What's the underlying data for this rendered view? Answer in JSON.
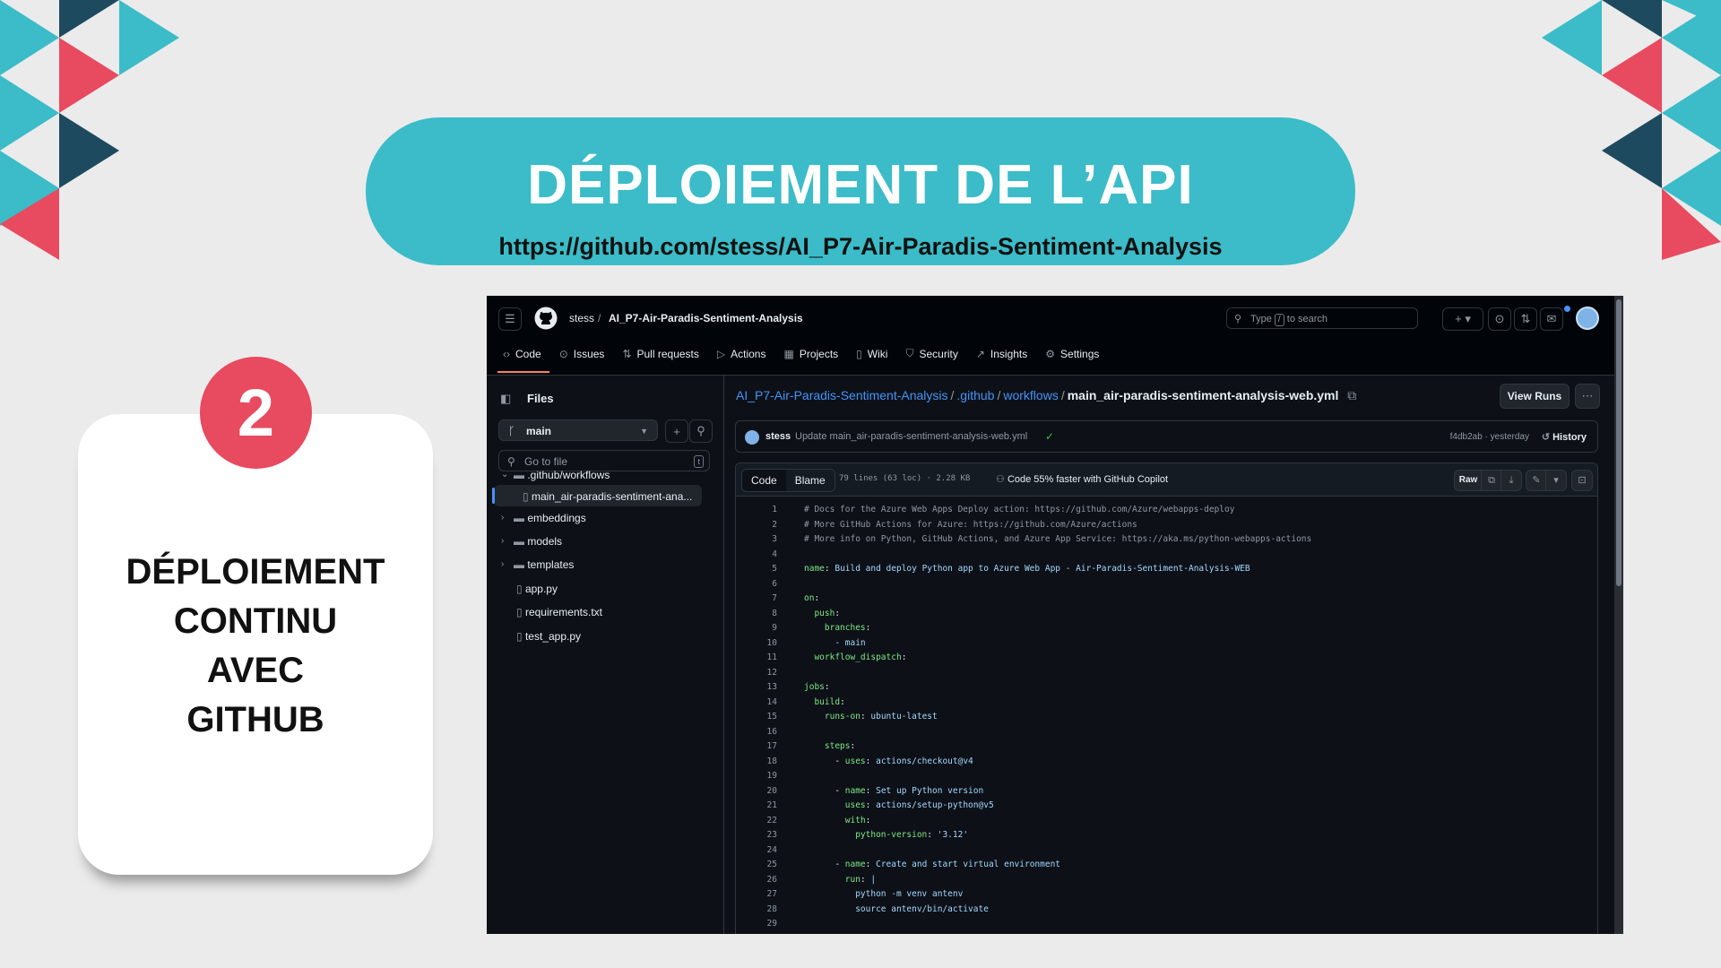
{
  "slide": {
    "title": "DÉPLOIEMENT DE L’API",
    "url": "https://github.com/stess/AI_P7-Air-Paradis-Sentiment-Analysis",
    "step_number": "2",
    "card_lines": [
      "DÉPLOIEMENT",
      "CONTINU",
      "AVEC",
      "GITHUB"
    ],
    "colors": {
      "teal": "#3bbcc8",
      "red": "#e84a5f",
      "navy": "#1e4a5f",
      "background": "#ebebeb"
    }
  },
  "github": {
    "owner": "stess",
    "repo": "AI_P7-Air-Paradis-Sentiment-Analysis",
    "search_placeholder_pre": "Type",
    "search_key": "/",
    "search_placeholder_post": "to search",
    "nav_tabs": [
      {
        "label": "Code",
        "icon": "code-icon"
      },
      {
        "label": "Issues",
        "icon": "issue-icon"
      },
      {
        "label": "Pull requests",
        "icon": "pull-request-icon"
      },
      {
        "label": "Actions",
        "icon": "play-icon"
      },
      {
        "label": "Projects",
        "icon": "table-icon"
      },
      {
        "label": "Wiki",
        "icon": "book-icon"
      },
      {
        "label": "Security",
        "icon": "shield-icon"
      },
      {
        "label": "Insights",
        "icon": "graph-icon"
      },
      {
        "label": "Settings",
        "icon": "gear-icon"
      }
    ],
    "sidebar": {
      "title": "Files",
      "branch": "main",
      "goto_placeholder": "Go to file",
      "goto_key": "t",
      "tree": [
        {
          "label": ".github/workflows",
          "type": "folder",
          "expanded": true
        },
        {
          "label": "main_air-paradis-sentiment-ana...",
          "type": "file",
          "selected": true
        },
        {
          "label": "embeddings",
          "type": "folder"
        },
        {
          "label": "models",
          "type": "folder"
        },
        {
          "label": "templates",
          "type": "folder"
        },
        {
          "label": "app.py",
          "type": "file"
        },
        {
          "label": "requirements.txt",
          "type": "file"
        },
        {
          "label": "test_app.py",
          "type": "file"
        }
      ]
    },
    "path": {
      "repo": "AI_P7-Air-Paradis-Sentiment-Analysis",
      "dir1": ".github",
      "dir2": "workflows",
      "file": "main_air-paradis-sentiment-analysis-web.yml"
    },
    "view_runs": "View Runs",
    "commit": {
      "author": "stess",
      "message": "Update main_air-paradis-sentiment-analysis-web.yml",
      "hash_time": "f4db2ab · yesterday",
      "history": "History"
    },
    "code_header": {
      "tab_code": "Code",
      "tab_blame": "Blame",
      "info": "79 lines (63 loc) · 2.28 KB",
      "copilot": "Code 55% faster with GitHub Copilot",
      "raw": "Raw"
    },
    "code_lines": [
      {
        "n": "1",
        "t": "# Docs for the Azure Web Apps Deploy action: https://github.com/Azure/webapps-deploy"
      },
      {
        "n": "2",
        "t": "# More GitHub Actions for Azure: https://github.com/Azure/actions"
      },
      {
        "n": "3",
        "t": "# More info on Python, GitHub Actions, and Azure App Service: https://aka.ms/python-webapps-actions"
      },
      {
        "n": "4",
        "t": ""
      },
      {
        "n": "5",
        "t": "name: Build and deploy Python app to Azure Web App - Air-Paradis-Sentiment-Analysis-WEB"
      },
      {
        "n": "6",
        "t": ""
      },
      {
        "n": "7",
        "t": "on:"
      },
      {
        "n": "8",
        "t": "  push:"
      },
      {
        "n": "9",
        "t": "    branches:"
      },
      {
        "n": "10",
        "t": "      - main"
      },
      {
        "n": "11",
        "t": "  workflow_dispatch:"
      },
      {
        "n": "12",
        "t": ""
      },
      {
        "n": "13",
        "t": "jobs:"
      },
      {
        "n": "14",
        "t": "  build:"
      },
      {
        "n": "15",
        "t": "    runs-on: ubuntu-latest"
      },
      {
        "n": "16",
        "t": ""
      },
      {
        "n": "17",
        "t": "    steps:"
      },
      {
        "n": "18",
        "t": "      - uses: actions/checkout@v4"
      },
      {
        "n": "19",
        "t": ""
      },
      {
        "n": "20",
        "t": "      - name: Set up Python version"
      },
      {
        "n": "21",
        "t": "        uses: actions/setup-python@v5"
      },
      {
        "n": "22",
        "t": "        with:"
      },
      {
        "n": "23",
        "t": "          python-version: '3.12'"
      },
      {
        "n": "24",
        "t": ""
      },
      {
        "n": "25",
        "t": "      - name: Create and start virtual environment"
      },
      {
        "n": "26",
        "t": "        run: |"
      },
      {
        "n": "27",
        "t": "          python -m venv antenv"
      },
      {
        "n": "28",
        "t": "          source antenv/bin/activate"
      },
      {
        "n": "29",
        "t": ""
      }
    ]
  }
}
